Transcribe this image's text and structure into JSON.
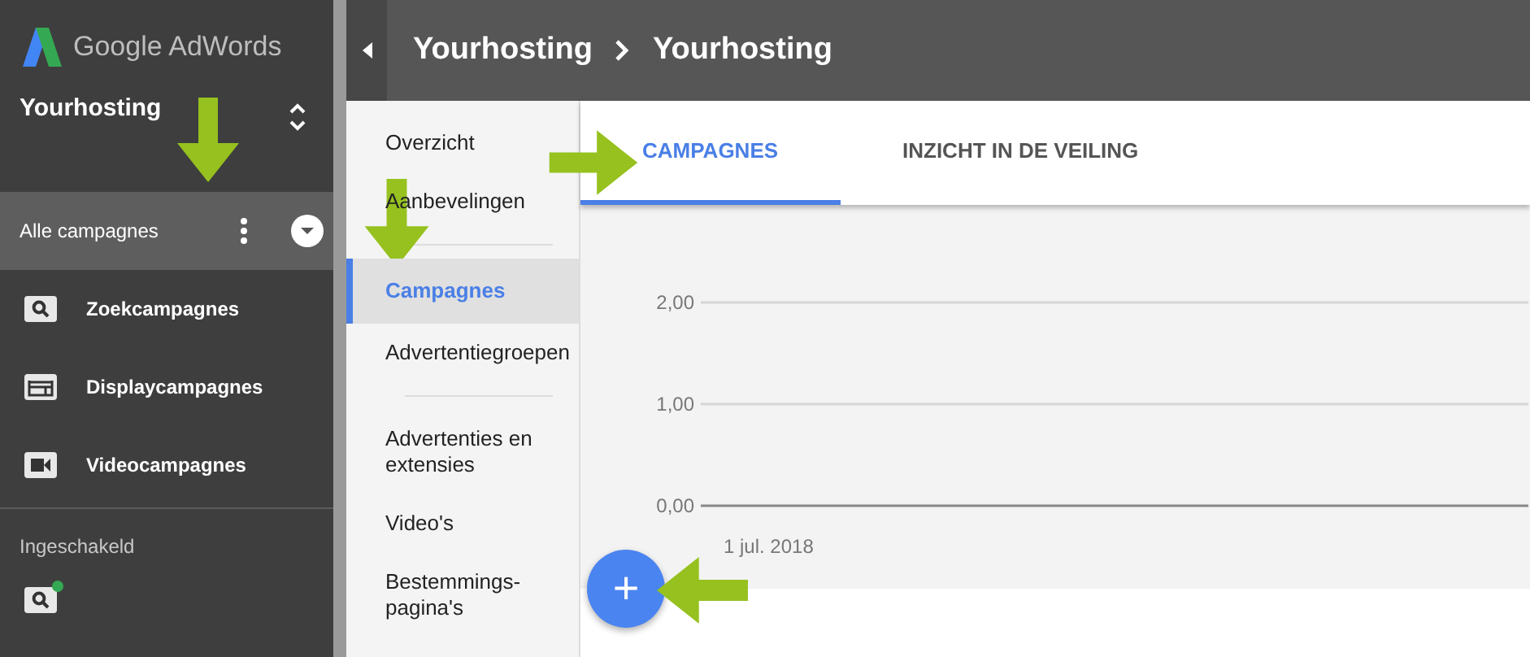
{
  "app": {
    "logo_text": "Google AdWords"
  },
  "account": {
    "name": "Yourhosting"
  },
  "sidebar": {
    "header": {
      "label": "Alle campagnes"
    },
    "items": [
      {
        "label": "Zoekcampagnes",
        "kind": "search"
      },
      {
        "label": "Displaycampagnes",
        "kind": "display"
      },
      {
        "label": "Videocampagnes",
        "kind": "video"
      }
    ],
    "section_label": "Ingeschakeld",
    "status_items": [
      {
        "kind": "search",
        "color": "#34a853"
      }
    ]
  },
  "breadcrumb": [
    "Yourhosting",
    "Yourhosting"
  ],
  "nav": {
    "groups": [
      [
        {
          "label": "Overzicht",
          "selected": false
        },
        {
          "label": "Aanbevelingen",
          "selected": false
        }
      ],
      [
        {
          "label": "Campagnes",
          "selected": true
        },
        {
          "label": "Advertentiegroepen",
          "selected": false
        }
      ],
      [
        {
          "label": "Advertenties en extensies",
          "selected": false
        },
        {
          "label": "Video's",
          "selected": false
        },
        {
          "label": "Bestemmings-pagina's",
          "selected": false
        }
      ]
    ]
  },
  "tabs": [
    {
      "label": "CAMPAGNES",
      "selected": true
    },
    {
      "label": "INZICHT IN DE VEILING",
      "selected": false
    }
  ],
  "chart": {
    "chart_data": {
      "type": "line",
      "ylim": [
        0,
        2
      ],
      "yticks": [
        {
          "value": 2,
          "label": "2,00"
        },
        {
          "value": 1,
          "label": "1,00"
        },
        {
          "value": 0,
          "label": "0,00"
        }
      ],
      "categories": [
        "1 jul. 2018"
      ]
    }
  },
  "fab": {
    "label": "+"
  }
}
